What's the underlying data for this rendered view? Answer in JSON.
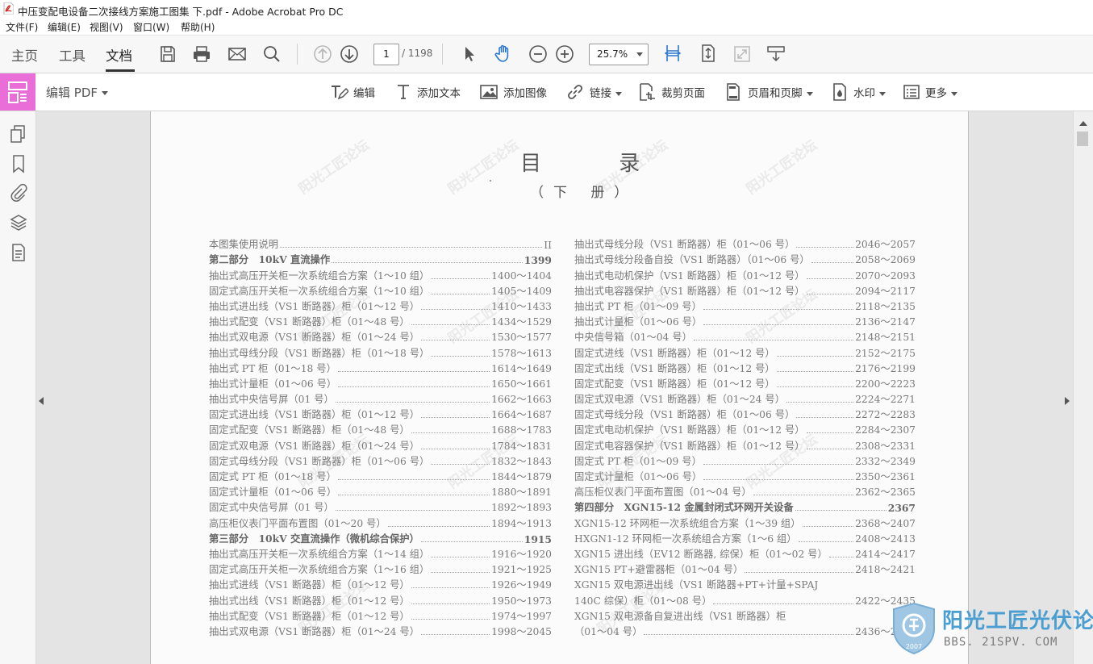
{
  "window": {
    "title": "中压变配电设备二次接线方案施工图集 下.pdf - Adobe Acrobat Pro DC"
  },
  "menu": [
    "文件(F)",
    "编辑(E)",
    "视图(V)",
    "窗口(W)",
    "帮助(H)"
  ],
  "tabs": {
    "home": "主页",
    "tools": "工具",
    "document": "文档"
  },
  "nav": {
    "current_page": "1",
    "total_pages": "/ 1198",
    "zoom": "25.7%"
  },
  "edit_toolbar": {
    "title": "编辑 PDF",
    "edit": "编辑",
    "add_text": "添加文本",
    "add_image": "添加图像",
    "link": "链接",
    "crop": "裁剪页面",
    "header_footer": "页眉和页脚",
    "watermark": "水印",
    "more": "更多"
  },
  "icons": [
    "pdf-file-icon",
    "save-icon",
    "print-icon",
    "mail-icon",
    "search-icon",
    "prev-page-icon",
    "next-page-icon",
    "select-cursor-icon",
    "hand-icon",
    "zoom-out-icon",
    "zoom-in-icon",
    "fit-width-icon",
    "fit-page-icon",
    "full-screen-icon",
    "read-mode-icon",
    "edit-pdf-icon",
    "thumbnails-icon",
    "bookmark-icon",
    "attachment-icon",
    "layers-icon",
    "document-properties-icon"
  ],
  "accent_color": "#e96ed8",
  "document": {
    "title": "目 录",
    "subtitle": "（下 册）",
    "watermark": "阳光工匠论坛",
    "toc_left": [
      {
        "text": "本图集使用说明",
        "page": "II",
        "head": false
      },
      {
        "text": "第二部分　10kV 直流操作",
        "page": "1399",
        "head": true
      },
      {
        "text": "抽出式高压开关柜一次系统组合方案（1～10 组）",
        "page": "1400～1404",
        "head": false
      },
      {
        "text": "固定式高压开关柜一次系统组合方案（1～10 组）",
        "page": "1405～1409",
        "head": false
      },
      {
        "text": "抽出式进出线（VS1 断路器）柜（01～12 号）",
        "page": "1410～1433",
        "head": false
      },
      {
        "text": "抽出式配变（VS1 断路器）柜（01～48 号）",
        "page": "1434～1529",
        "head": false
      },
      {
        "text": "抽出式双电源（VS1 断路器）柜（01～24 号）",
        "page": "1530～1577",
        "head": false
      },
      {
        "text": "抽出式母线分段（VS1 断路器）柜（01～18 号）",
        "page": "1578～1613",
        "head": false
      },
      {
        "text": "抽出式 PT 柜（01～18 号）",
        "page": "1614～1649",
        "head": false
      },
      {
        "text": "抽出式计量柜（01～06 号）",
        "page": "1650～1661",
        "head": false
      },
      {
        "text": "抽出式中央信号屏（01 号）",
        "page": "1662～1663",
        "head": false
      },
      {
        "text": "固定式进出线（VS1 断路器）柜（01～12 号）",
        "page": "1664～1687",
        "head": false
      },
      {
        "text": "固定式配变（VS1 断路器）柜（01～48 号）",
        "page": "1688～1783",
        "head": false
      },
      {
        "text": "固定式双电源（VS1 断路器）柜（01～24 号）",
        "page": "1784～1831",
        "head": false
      },
      {
        "text": "固定式母线分段（VS1 断路器）柜（01～06 号）",
        "page": "1832～1843",
        "head": false
      },
      {
        "text": "固定式 PT 柜（01～18 号）",
        "page": "1844～1879",
        "head": false
      },
      {
        "text": "固定式计量柜（01～06 号）",
        "page": "1880～1891",
        "head": false
      },
      {
        "text": "固定式中央信号屏（01 号）",
        "page": "1892～1893",
        "head": false
      },
      {
        "text": "高压柜仪表门平面布置图（01～20 号）",
        "page": "1894～1913",
        "head": false
      },
      {
        "text": "第三部分　10kV 交直流操作（微机综合保护）",
        "page": "1915",
        "head": true
      },
      {
        "text": "抽出式高压开关柜一次系统组合方案（1～14 组）",
        "page": "1916～1920",
        "head": false
      },
      {
        "text": "固定式高压开关柜一次系统组合方案（1～16 组）",
        "page": "1921～1925",
        "head": false
      },
      {
        "text": "抽出式进线（VS1 断路器）柜（01～12 号）",
        "page": "1926～1949",
        "head": false
      },
      {
        "text": "抽出式出线（VS1 断路器）柜（01～12 号）",
        "page": "1950～1973",
        "head": false
      },
      {
        "text": "抽出式配变（VS1 断路器）柜（01～12 号）",
        "page": "1974～1997",
        "head": false
      },
      {
        "text": "抽出式双电源（VS1 断路器）柜（01～24 号）",
        "page": "1998～2045",
        "head": false
      }
    ],
    "toc_right": [
      {
        "text": "抽出式母线分段（VS1 断路器）柜（01～06 号）",
        "page": "2046～2057",
        "head": false
      },
      {
        "text": "抽出式母线分段备自投（VS1 断路器）（01～06 号）",
        "page": "2058～2069",
        "head": false
      },
      {
        "text": "抽出式电动机保护（VS1 断路器）柜（01～12 号）",
        "page": "2070～2093",
        "head": false
      },
      {
        "text": "抽出式电容器保护（VS1 断路器）柜（01～12 号）",
        "page": "2094～2117",
        "head": false
      },
      {
        "text": "抽出式 PT 柜（01～09 号）",
        "page": "2118～2135",
        "head": false
      },
      {
        "text": "抽出式计量柜（01～06 号）",
        "page": "2136～2147",
        "head": false
      },
      {
        "text": "中央信号箱（01～04 号）",
        "page": "2148～2151",
        "head": false
      },
      {
        "text": "固定式进线（VS1 断路器）柜（01～12 号）",
        "page": "2152～2175",
        "head": false
      },
      {
        "text": "固定式出线（VS1 断路器）柜（01～12 号）",
        "page": "2176～2199",
        "head": false
      },
      {
        "text": "固定式配变（VS1 断路器）柜（01～12 号）",
        "page": "2200～2223",
        "head": false
      },
      {
        "text": "固定式双电源（VS1 断路器）柜（01～24 号）",
        "page": "2224～2271",
        "head": false
      },
      {
        "text": "固定式母线分段（VS1 断路器）柜（01～06 号）",
        "page": "2272～2283",
        "head": false
      },
      {
        "text": "固定式电动机保护（VS1 断路器）柜（01～12 号）",
        "page": "2284～2307",
        "head": false
      },
      {
        "text": "固定式电容器保护（VS1 断路器）柜（01～12 号）",
        "page": "2308～2331",
        "head": false
      },
      {
        "text": "固定式 PT 柜（01～09 号）",
        "page": "2332～2349",
        "head": false
      },
      {
        "text": "固定式计量柜（01～06 号）",
        "page": "2350～2361",
        "head": false
      },
      {
        "text": "高压柜仪表门平面布置图（01～04 号）",
        "page": "2362～2365",
        "head": false
      },
      {
        "text": "第四部分　XGN15-12 金属封闭式环网开关设备",
        "page": "2367",
        "head": true
      },
      {
        "text": "XGN15-12 环网柜一次系统组合方案（1～39 组）",
        "page": "2368～2407",
        "head": false
      },
      {
        "text": "HXGN1-12 环网柜一次系统组合方案（1～6 组）",
        "page": "2408～2413",
        "head": false
      },
      {
        "text": "XGN15 进出线（EV12 断路器, 综保）柜（01～02 号）",
        "page": "2414～2417",
        "head": false
      },
      {
        "text": "XGN15 PT+避雷器柜（01～04 号）",
        "page": "2418～2421",
        "head": false
      },
      {
        "text": "XGN15 双电源进出线（VS1 断路器+PT+计量+SPAJ",
        "page": "",
        "head": false
      },
      {
        "text": "140C 综保）柜（01～08 号）",
        "page": "2422～2435",
        "head": false
      },
      {
        "text": "XGN15 双电源备自复进出线（VS1 断路器）柜",
        "page": "",
        "head": false
      },
      {
        "text": "（01～04 号）",
        "page": "2436～2441",
        "head": false
      }
    ]
  },
  "brand": {
    "name": "阳光工匠光伏论坛",
    "url": "BBS. 21SPV. COM",
    "year": "2007"
  }
}
